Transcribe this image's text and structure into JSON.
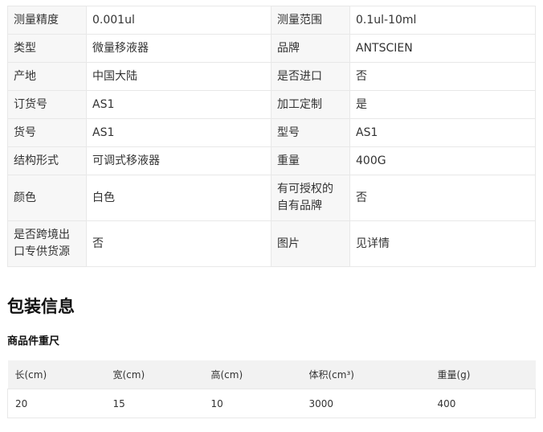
{
  "spec_rows": [
    {
      "k1": "测量精度",
      "v1": "0.001ul",
      "k2": "测量范围",
      "v2": "0.1ul-10ml"
    },
    {
      "k1": "类型",
      "v1": "微量移液器",
      "k2": "品牌",
      "v2": "ANTSCIEN"
    },
    {
      "k1": "产地",
      "v1": "中国大陆",
      "k2": "是否进口",
      "v2": "否"
    },
    {
      "k1": "订货号",
      "v1": "AS1",
      "k2": "加工定制",
      "v2": "是"
    },
    {
      "k1": "货号",
      "v1": "AS1",
      "k2": "型号",
      "v2": "AS1"
    },
    {
      "k1": "结构形式",
      "v1": "可调式移液器",
      "k2": "重量",
      "v2": "400G"
    },
    {
      "k1": "颜色",
      "v1": "白色",
      "k2": "有可授权的自有品牌",
      "v2": "否"
    },
    {
      "k1": "是否跨境出口专供货源",
      "v1": "否",
      "k2": "图片",
      "v2": "见详情"
    }
  ],
  "package": {
    "title": "包装信息",
    "subtitle": "商品件重尺",
    "headers": [
      "长(cm)",
      "宽(cm)",
      "高(cm)",
      "体积(cm³)",
      "重量(g)"
    ],
    "row": [
      "20",
      "15",
      "10",
      "3000",
      "400"
    ]
  }
}
